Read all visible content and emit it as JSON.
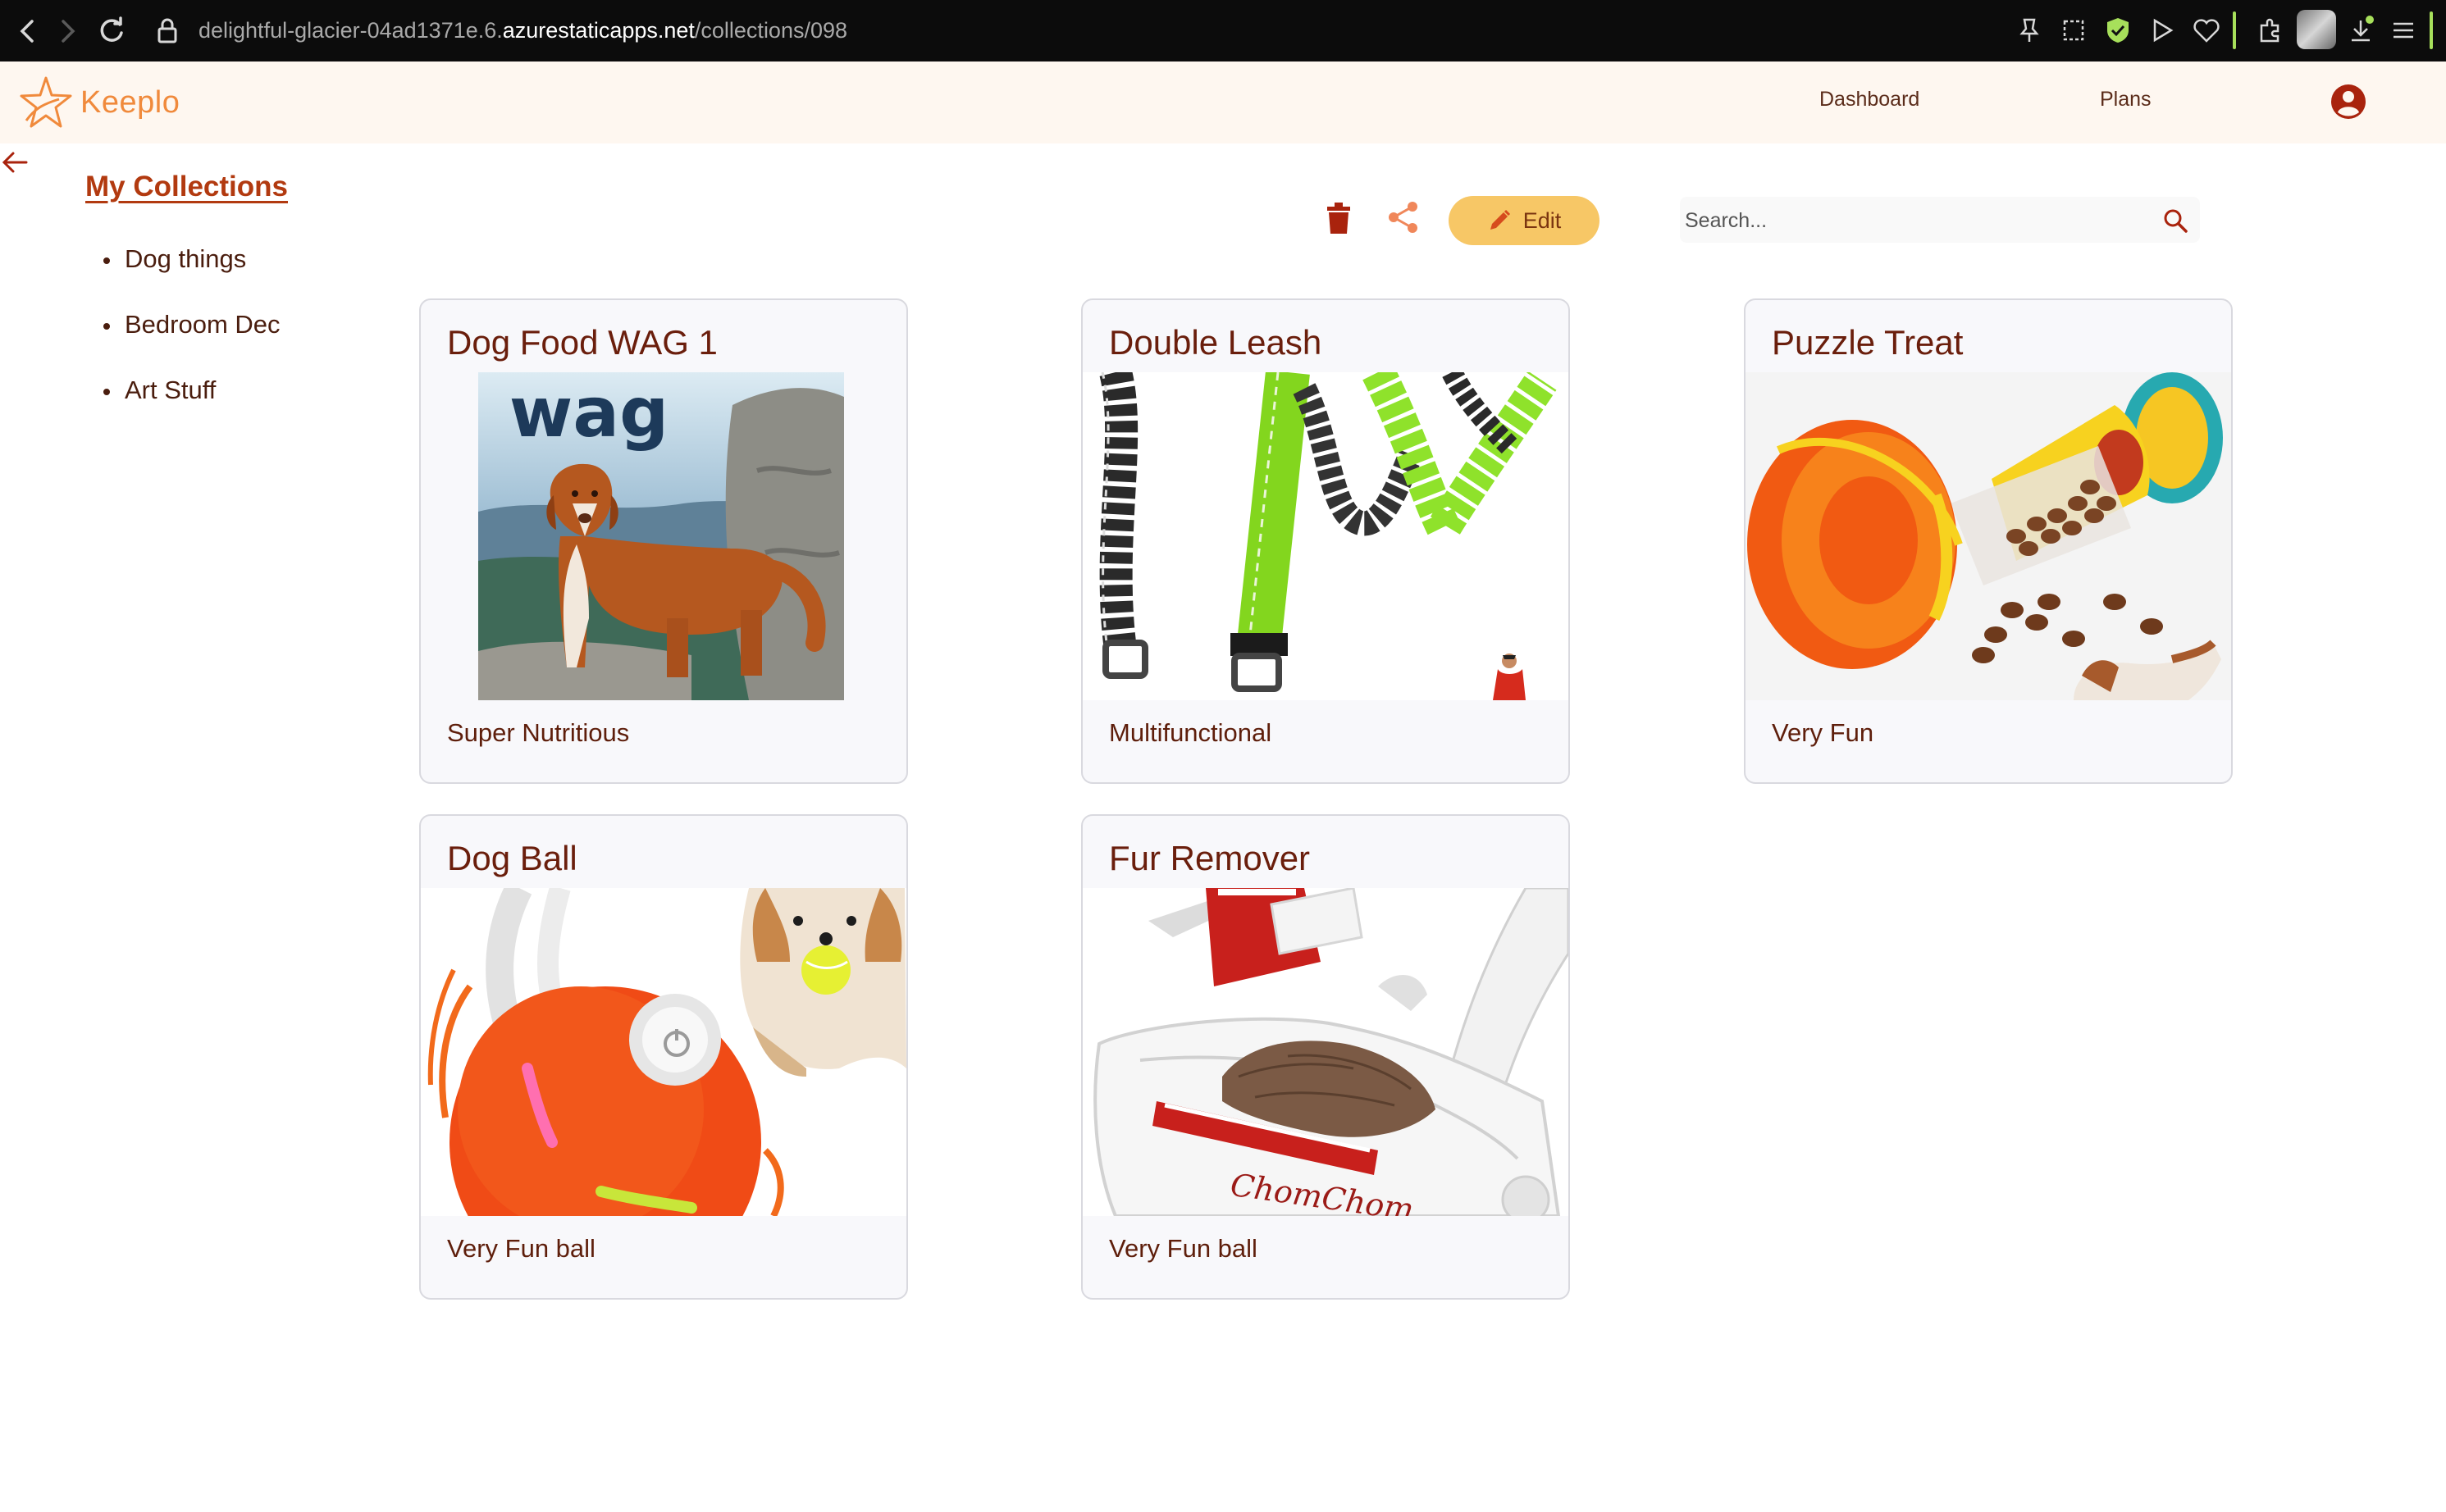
{
  "browser": {
    "url_prefix": "delightful-glacier-04ad1371e.6.",
    "url_host": "azurestaticapps.net",
    "url_path": "/collections/098"
  },
  "header": {
    "logo_text": "Keeplo",
    "nav": [
      {
        "label": "Dashboard"
      },
      {
        "label": "Plans"
      }
    ],
    "brand_color": "#f08a3c"
  },
  "sidebar": {
    "title": "My Collections",
    "items": [
      {
        "label": "Dog things"
      },
      {
        "label": "Bedroom Dec"
      },
      {
        "label": "Art Stuff"
      }
    ]
  },
  "toolbar": {
    "delete_icon": "trash-icon",
    "share_icon": "share-icon",
    "edit_label": "Edit",
    "search_placeholder": "Search..."
  },
  "items": [
    {
      "title": "Dog Food WAG 1",
      "description": "Super Nutritious",
      "image": "dog-food-wag-image"
    },
    {
      "title": "Double Leash",
      "description": "Multifunctional",
      "image": "double-leash-image"
    },
    {
      "title": "Puzzle Treat",
      "description": "Very Fun",
      "image": "puzzle-treat-image"
    },
    {
      "title": "Dog Ball",
      "description": "Very Fun ball",
      "image": "dog-ball-image"
    },
    {
      "title": "Fur Remover",
      "description": "Very Fun ball",
      "image": "fur-remover-image"
    }
  ],
  "wag_logo_text": "wag",
  "chom_logo_text": "ChomChom"
}
